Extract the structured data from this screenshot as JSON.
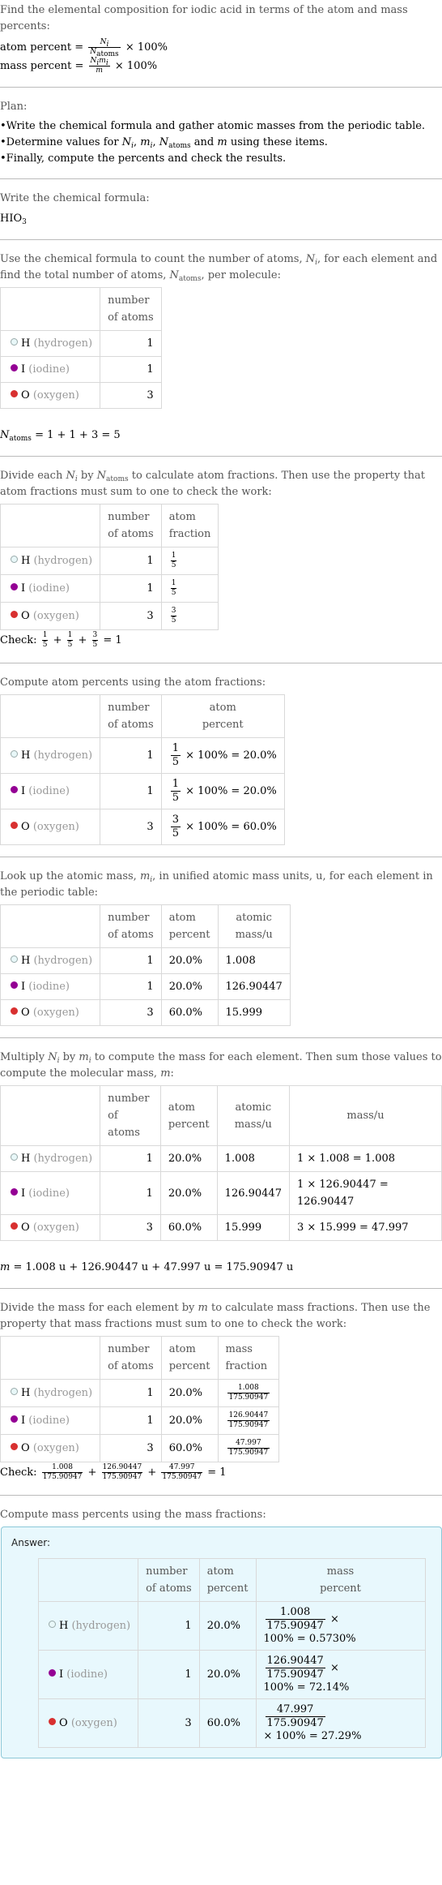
{
  "problem": {
    "intro": "Find the elemental composition for iodic acid in terms of the atom and mass percents:",
    "atom_percent_label": "atom percent =",
    "mass_percent_label": "mass percent =",
    "times100": "× 100%"
  },
  "plan": {
    "title": "Plan:",
    "items": [
      "Write the chemical formula and gather atomic masses from the periodic table.",
      "Determine values for N_i, m_i, N_atoms and m using these items.",
      "Finally, compute the percents and check the results."
    ]
  },
  "formula": {
    "intro": "Write the chemical formula:",
    "base": "HIO",
    "subscript": "3"
  },
  "elements": [
    {
      "symbol": "H",
      "name": "(hydrogen)",
      "color": "#e8f7f8",
      "border": "#9aa",
      "count": "1",
      "atom_fraction": [
        "1",
        "5"
      ],
      "atom_percent": "20.0%",
      "atomic_mass": "1.008",
      "mass_calc": "1 × 1.008 = 1.008",
      "mass": "1.008",
      "mass_percent_result": "100% = 0.5730%"
    },
    {
      "symbol": "I",
      "name": "(iodine)",
      "color": "#940094",
      "border": "#940094",
      "count": "1",
      "atom_fraction": [
        "1",
        "5"
      ],
      "atom_percent": "20.0%",
      "atomic_mass": "126.90447",
      "mass_calc": "1 × 126.90447 = 126.90447",
      "mass": "126.90447",
      "mass_percent_result": "100% = 72.14%"
    },
    {
      "symbol": "O",
      "name": "(oxygen)",
      "color": "#d83030",
      "border": "#d83030",
      "count": "3",
      "atom_fraction": [
        "3",
        "5"
      ],
      "atom_percent": "60.0%",
      "atomic_mass": "15.999",
      "mass_calc": "3 × 15.999 = 47.997",
      "mass": "47.997",
      "mass_percent_result": "× 100% = 27.29%"
    }
  ],
  "headers": {
    "number_of_atoms": "number of atoms",
    "atom_fraction": "atom fraction",
    "atom_percent": "atom percent",
    "atomic_mass": "atomic mass/u",
    "mass": "mass/u",
    "mass_fraction": "mass fraction",
    "mass_percent": "mass percent"
  },
  "step_count": {
    "intro": "Use the chemical formula to count the number of atoms, N_i, for each element and find the total number of atoms, N_atoms, per molecule:",
    "result": "= 1 + 1 + 3 = 5"
  },
  "step_fraction": {
    "intro": "Divide each N_i by N_atoms to calculate atom fractions. Then use the property that atom fractions must sum to one to check the work:",
    "check_label": "Check:",
    "check_result": "= 1"
  },
  "step_atom_percent": {
    "intro": "Compute atom percents using the atom fractions:",
    "times100": "× 100% ="
  },
  "step_lookup": {
    "intro": "Look up the atomic mass, m_i, in unified atomic mass units, u, for each element in the periodic table:"
  },
  "step_mass": {
    "intro": "Multiply N_i by m_i to compute the mass for each element. Then sum those values to compute the molecular mass, m:",
    "sum": "= 1.008 u + 126.90447 u + 47.997 u = 175.90947 u"
  },
  "step_mass_fraction": {
    "intro": "Divide the mass for each element by m to calculate mass fractions. Then use the property that mass fractions must sum to one to check the work:",
    "denominator": "175.90947",
    "check_label": "Check:",
    "check_result": "= 1"
  },
  "step_mass_percent": {
    "intro": "Compute mass percents using the mass fractions:",
    "answer_label": "Answer:",
    "times": "×"
  }
}
